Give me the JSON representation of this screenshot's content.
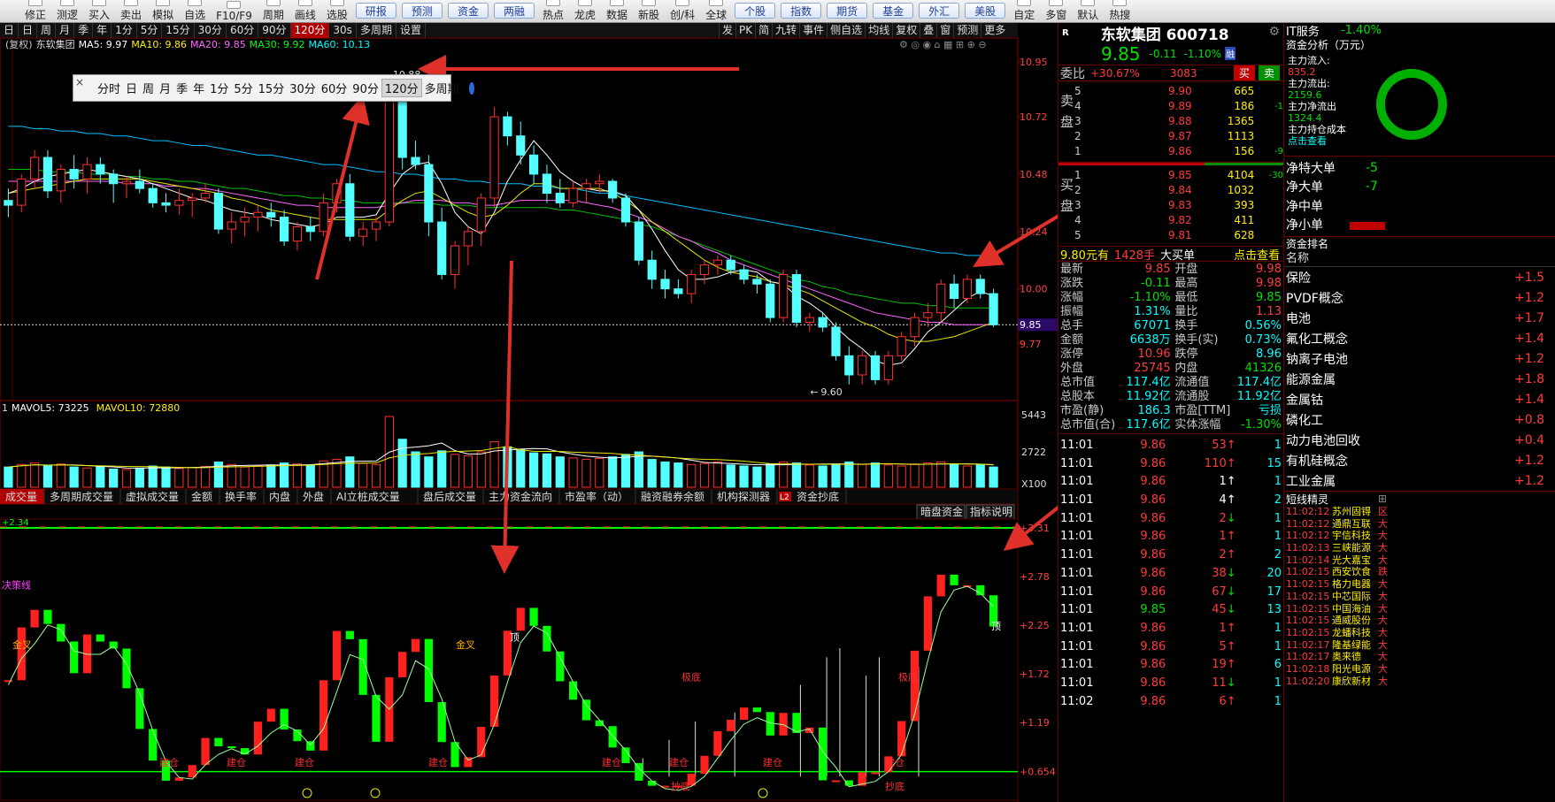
{
  "toolbar": {
    "items": [
      "修正",
      "测逻",
      "买入",
      "卖出",
      "模拟",
      "自选",
      "F10/F9",
      "周期",
      "画线",
      "选股"
    ],
    "buttons": [
      "研报",
      "预测",
      "资金",
      "两融"
    ],
    "items2": [
      "热点",
      "龙虎",
      "数据",
      "新股",
      "创/科"
    ],
    "item_global": "全球",
    "buttons2": [
      "个股",
      "指数",
      "期货",
      "基金",
      "外汇",
      "美股"
    ],
    "items3": [
      "自定",
      "多窗",
      "默认",
      "热搜"
    ]
  },
  "periodbar": {
    "items": [
      "日",
      "日",
      "周",
      "月",
      "季",
      "年",
      "1分",
      "5分",
      "15分",
      "30分",
      "60分",
      "90分",
      "120分",
      "30s",
      "多周期",
      "设置"
    ],
    "active_index": 12,
    "right_tools": [
      "发",
      "PK",
      "简",
      "九转",
      "事件",
      "侧自选",
      "均线",
      "复权",
      "叠",
      "窗",
      "预测",
      "更多"
    ]
  },
  "chart_header": {
    "fq": "(复权)",
    "name": "东软集团",
    "ma5": "MA5: 9.97",
    "ma10": "MA10: 9.86",
    "ma20": "MA20: 9.85",
    "ma30": "MA30: 9.92",
    "ma60": "MA60: 10.13"
  },
  "popup": {
    "items": [
      "分时",
      "日",
      "周",
      "月",
      "季",
      "年",
      "1分",
      "5分",
      "15分",
      "30分",
      "60分",
      "90分",
      "120分",
      "多周期"
    ],
    "selected": "120分",
    "close": "×"
  },
  "price_axis": [
    "10.95",
    "10.72",
    "10.48",
    "10.24",
    "10.00",
    "9.77"
  ],
  "last_price_tag": "9.85",
  "high_label": "10.88",
  "low_label": "9.60",
  "vol_header": {
    "prefix": "1",
    "mavol5": "MAVOL5: 73225",
    "mavol10": "MAVOL10: 72880"
  },
  "vol_axis": [
    "5443",
    "2722",
    "X100"
  ],
  "tabs": [
    "成交量",
    "多周期成交量",
    "虚拟成交量",
    "金额",
    "换手率",
    "内盘",
    "外盘",
    "AI立桩成交量",
    "盘后成交量",
    "主力资金流向",
    "市盈率（动）",
    "融资融券余额",
    "机构探测器",
    "资金抄底"
  ],
  "tab_l2_badge": "L2",
  "ind_buttons": [
    "暗盘资金",
    "指标说明"
  ],
  "ind_header_value": "+2.34",
  "ind_axis": [
    "+3.31",
    "+2.78",
    "+2.25",
    "+1.72",
    "+1.19",
    "+0.654"
  ],
  "ind_labels": {
    "jj": "决策线",
    "jincha1": "金叉",
    "jincha2": "金叉",
    "ding1": "顶",
    "ding2": "顶",
    "jidi1": "极底",
    "jidi2": "极底",
    "jiancang": "建仓",
    "chaodi": "抄底"
  },
  "chart_data": {
    "type": "candlestick",
    "candles": [
      [
        10.37,
        10.42,
        10.3,
        10.35
      ],
      [
        10.35,
        10.48,
        10.32,
        10.46
      ],
      [
        10.46,
        10.58,
        10.42,
        10.55
      ],
      [
        10.55,
        10.58,
        10.38,
        10.41
      ],
      [
        10.41,
        10.52,
        10.36,
        10.5
      ],
      [
        10.5,
        10.56,
        10.42,
        10.46
      ],
      [
        10.46,
        10.55,
        10.4,
        10.52
      ],
      [
        10.52,
        10.55,
        10.44,
        10.48
      ],
      [
        10.48,
        10.5,
        10.36,
        10.44
      ],
      [
        10.44,
        10.47,
        10.38,
        10.45
      ],
      [
        10.45,
        10.5,
        10.4,
        10.42
      ],
      [
        10.42,
        10.44,
        10.34,
        10.36
      ],
      [
        10.36,
        10.4,
        10.32,
        10.35
      ],
      [
        10.35,
        10.42,
        10.31,
        10.37
      ],
      [
        10.37,
        10.4,
        10.3,
        10.38
      ],
      [
        10.38,
        10.44,
        10.36,
        10.4
      ],
      [
        10.4,
        10.42,
        10.23,
        10.25
      ],
      [
        10.25,
        10.32,
        10.19,
        10.28
      ],
      [
        10.28,
        10.34,
        10.22,
        10.3
      ],
      [
        10.3,
        10.35,
        10.24,
        10.32
      ],
      [
        10.32,
        10.36,
        10.26,
        10.3
      ],
      [
        10.3,
        10.33,
        10.18,
        10.2
      ],
      [
        10.2,
        10.28,
        10.16,
        10.26
      ],
      [
        10.26,
        10.3,
        10.2,
        10.24
      ],
      [
        10.24,
        10.4,
        10.22,
        10.36
      ],
      [
        10.36,
        10.46,
        10.32,
        10.44
      ],
      [
        10.44,
        10.48,
        10.2,
        10.22
      ],
      [
        10.22,
        10.28,
        10.18,
        10.25
      ],
      [
        10.25,
        10.3,
        10.2,
        10.28
      ],
      [
        10.28,
        10.88,
        10.26,
        10.8
      ],
      [
        10.8,
        10.88,
        10.5,
        10.55
      ],
      [
        10.55,
        10.62,
        10.5,
        10.52
      ],
      [
        10.52,
        10.56,
        10.22,
        10.28
      ],
      [
        10.28,
        10.34,
        10.04,
        10.06
      ],
      [
        10.06,
        10.2,
        10.0,
        10.18
      ],
      [
        10.18,
        10.26,
        10.1,
        10.24
      ],
      [
        10.24,
        10.4,
        10.18,
        10.38
      ],
      [
        10.38,
        10.76,
        10.34,
        10.72
      ],
      [
        10.72,
        10.74,
        10.6,
        10.64
      ],
      [
        10.64,
        10.7,
        10.52,
        10.56
      ],
      [
        10.56,
        10.6,
        10.44,
        10.48
      ],
      [
        10.48,
        10.52,
        10.36,
        10.4
      ],
      [
        10.4,
        10.46,
        10.34,
        10.36
      ],
      [
        10.36,
        10.45,
        10.34,
        10.42
      ],
      [
        10.42,
        10.46,
        10.36,
        10.44
      ],
      [
        10.44,
        10.48,
        10.4,
        10.45
      ],
      [
        10.45,
        10.46,
        10.36,
        10.38
      ],
      [
        10.38,
        10.4,
        10.26,
        10.28
      ],
      [
        10.28,
        10.3,
        10.1,
        10.12
      ],
      [
        10.12,
        10.16,
        10.0,
        10.04
      ],
      [
        10.04,
        10.08,
        9.96,
        10.0
      ],
      [
        10.0,
        10.04,
        9.96,
        9.98
      ],
      [
        9.98,
        10.08,
        9.94,
        10.06
      ],
      [
        10.06,
        10.12,
        10.02,
        10.1
      ],
      [
        10.1,
        10.14,
        10.06,
        10.12
      ],
      [
        10.12,
        10.14,
        10.06,
        10.08
      ],
      [
        10.08,
        10.1,
        10.02,
        10.04
      ],
      [
        10.04,
        10.06,
        9.98,
        10.02
      ],
      [
        10.02,
        10.04,
        9.86,
        9.88
      ],
      [
        9.88,
        10.08,
        9.86,
        10.06
      ],
      [
        10.06,
        10.08,
        9.84,
        9.86
      ],
      [
        9.86,
        9.9,
        9.82,
        9.88
      ],
      [
        9.88,
        9.9,
        9.82,
        9.84
      ],
      [
        9.84,
        9.86,
        9.7,
        9.72
      ],
      [
        9.72,
        9.76,
        9.6,
        9.64
      ],
      [
        9.64,
        9.74,
        9.6,
        9.72
      ],
      [
        9.72,
        9.74,
        9.6,
        9.62
      ],
      [
        9.62,
        9.74,
        9.6,
        9.72
      ],
      [
        9.72,
        9.82,
        9.7,
        9.8
      ],
      [
        9.8,
        9.9,
        9.76,
        9.88
      ],
      [
        9.88,
        9.94,
        9.84,
        9.9
      ],
      [
        9.9,
        10.04,
        9.86,
        10.02
      ],
      [
        10.02,
        10.06,
        9.92,
        9.96
      ],
      [
        9.96,
        10.06,
        9.94,
        10.04
      ],
      [
        10.04,
        10.06,
        9.96,
        9.98
      ],
      [
        9.98,
        10.0,
        9.84,
        9.85
      ]
    ],
    "ma5": [
      10.4,
      10.42,
      10.45,
      10.47,
      10.48,
      10.49,
      10.5,
      10.49,
      10.48,
      10.47,
      10.46,
      10.44,
      10.42,
      10.4,
      10.38,
      10.37,
      10.35,
      10.33,
      10.32,
      10.31,
      10.29,
      10.28,
      10.27,
      10.26,
      10.27,
      10.3,
      10.3,
      10.3,
      10.31,
      10.4,
      10.48,
      10.52,
      10.53,
      10.44,
      10.32,
      10.26,
      10.23,
      10.32,
      10.45,
      10.54,
      10.62,
      10.56,
      10.49,
      10.45,
      10.42,
      10.41,
      10.41,
      10.39,
      10.33,
      10.25,
      10.16,
      10.08,
      10.04,
      10.04,
      10.05,
      10.07,
      10.08,
      10.07,
      10.03,
      10.02,
      9.97,
      9.94,
      9.9,
      9.84,
      9.79,
      9.75,
      9.7,
      9.68,
      9.69,
      9.75,
      9.82,
      9.86,
      9.91,
      9.96,
      9.99,
      9.97
    ],
    "ma10": [
      10.4,
      10.41,
      10.42,
      10.43,
      10.44,
      10.45,
      10.46,
      10.46,
      10.46,
      10.46,
      10.46,
      10.45,
      10.44,
      10.43,
      10.42,
      10.41,
      10.4,
      10.38,
      10.37,
      10.35,
      10.33,
      10.32,
      10.31,
      10.3,
      10.29,
      10.29,
      10.29,
      10.29,
      10.29,
      10.33,
      10.37,
      10.4,
      10.41,
      10.38,
      10.35,
      10.32,
      10.3,
      10.31,
      10.35,
      10.4,
      10.44,
      10.44,
      10.42,
      10.42,
      10.42,
      10.42,
      10.4,
      10.37,
      10.33,
      10.28,
      10.24,
      10.2,
      10.16,
      10.12,
      10.09,
      10.07,
      10.06,
      10.05,
      10.03,
      10.02,
      10.0,
      9.98,
      9.95,
      9.92,
      9.89,
      9.86,
      9.84,
      9.81,
      9.79,
      9.78,
      9.78,
      9.79,
      9.8,
      9.82,
      9.84,
      9.86
    ],
    "ma20": [
      10.45,
      10.45,
      10.45,
      10.45,
      10.45,
      10.45,
      10.45,
      10.45,
      10.45,
      10.44,
      10.44,
      10.44,
      10.43,
      10.43,
      10.42,
      10.42,
      10.41,
      10.4,
      10.39,
      10.38,
      10.37,
      10.36,
      10.35,
      10.35,
      10.34,
      10.34,
      10.34,
      10.34,
      10.34,
      10.35,
      10.36,
      10.37,
      10.37,
      10.37,
      10.36,
      10.36,
      10.35,
      10.35,
      10.36,
      10.37,
      10.37,
      10.37,
      10.37,
      10.37,
      10.36,
      10.35,
      10.34,
      10.32,
      10.3,
      10.28,
      10.25,
      10.22,
      10.2,
      10.17,
      10.15,
      10.12,
      10.1,
      10.08,
      10.06,
      10.04,
      10.02,
      10.0,
      9.98,
      9.96,
      9.94,
      9.92,
      9.9,
      9.89,
      9.88,
      9.87,
      9.86,
      9.86,
      9.85,
      9.85,
      9.85,
      9.85
    ],
    "ma30": [
      10.5,
      10.5,
      10.5,
      10.49,
      10.49,
      10.49,
      10.48,
      10.48,
      10.48,
      10.47,
      10.47,
      10.46,
      10.46,
      10.45,
      10.45,
      10.44,
      10.43,
      10.42,
      10.42,
      10.41,
      10.4,
      10.39,
      10.39,
      10.38,
      10.38,
      10.37,
      10.37,
      10.36,
      10.36,
      10.36,
      10.36,
      10.36,
      10.36,
      10.35,
      10.35,
      10.35,
      10.34,
      10.34,
      10.34,
      10.34,
      10.34,
      10.34,
      10.33,
      10.33,
      10.32,
      10.31,
      10.3,
      10.29,
      10.27,
      10.26,
      10.24,
      10.22,
      10.2,
      10.18,
      10.16,
      10.14,
      10.12,
      10.1,
      10.08,
      10.06,
      10.04,
      10.03,
      10.01,
      10.0,
      9.98,
      9.97,
      9.96,
      9.95,
      9.94,
      9.94,
      9.93,
      9.93,
      9.92,
      9.92,
      9.92,
      9.92
    ],
    "ma60": [
      10.68,
      10.68,
      10.67,
      10.67,
      10.66,
      10.66,
      10.65,
      10.65,
      10.64,
      10.64,
      10.63,
      10.62,
      10.62,
      10.61,
      10.6,
      10.6,
      10.59,
      10.58,
      10.57,
      10.56,
      10.56,
      10.55,
      10.54,
      10.53,
      10.52,
      10.52,
      10.51,
      10.5,
      10.49,
      10.49,
      10.48,
      10.48,
      10.47,
      10.46,
      10.46,
      10.45,
      10.45,
      10.44,
      10.44,
      10.44,
      10.43,
      10.43,
      10.42,
      10.42,
      10.41,
      10.4,
      10.4,
      10.39,
      10.38,
      10.37,
      10.36,
      10.35,
      10.34,
      10.33,
      10.32,
      10.31,
      10.3,
      10.29,
      10.28,
      10.27,
      10.26,
      10.25,
      10.24,
      10.23,
      10.22,
      10.21,
      10.2,
      10.19,
      10.18,
      10.17,
      10.16,
      10.15,
      10.15,
      10.14,
      10.14,
      10.13
    ],
    "volumes": [
      40,
      45,
      48,
      42,
      46,
      40,
      38,
      41,
      36,
      35,
      38,
      42,
      40,
      37,
      39,
      41,
      50,
      45,
      40,
      42,
      44,
      48,
      46,
      43,
      52,
      55,
      60,
      47,
      45,
      140,
      95,
      70,
      60,
      72,
      65,
      62,
      70,
      90,
      80,
      75,
      68,
      66,
      60,
      58,
      55,
      57,
      60,
      65,
      70,
      55,
      50,
      48,
      45,
      47,
      50,
      44,
      42,
      40,
      46,
      50,
      48,
      44,
      42,
      46,
      50,
      45,
      48,
      44,
      42,
      46,
      48,
      50,
      45,
      42,
      44,
      40
    ],
    "ylim": [
      9.54,
      11.02
    ]
  },
  "right": {
    "watch_prefix": "R",
    "title": "东软集团 600718",
    "price": "9.85",
    "change": "-0.11",
    "pct": "-1.10%",
    "tag": "融",
    "weibi_label": "委比",
    "weibi": "+30.67%",
    "weibi_diff": "3083",
    "buy_btn": "买",
    "sell_btn": "卖",
    "sell_side": "卖盘",
    "buy_side": "买盘",
    "asks": [
      {
        "lvl": "5",
        "p": "9.90",
        "v": "665",
        "d": ""
      },
      {
        "lvl": "4",
        "p": "9.89",
        "v": "186",
        "d": "-1"
      },
      {
        "lvl": "3",
        "p": "9.88",
        "v": "1365",
        "d": ""
      },
      {
        "lvl": "2",
        "p": "9.87",
        "v": "1113",
        "d": ""
      },
      {
        "lvl": "1",
        "p": "9.86",
        "v": "156",
        "d": "-9"
      }
    ],
    "bids": [
      {
        "lvl": "1",
        "p": "9.85",
        "v": "4104",
        "d": "-30"
      },
      {
        "lvl": "2",
        "p": "9.84",
        "v": "1032",
        "d": ""
      },
      {
        "lvl": "3",
        "p": "9.83",
        "v": "393",
        "d": ""
      },
      {
        "lvl": "4",
        "p": "9.82",
        "v": "411",
        "d": ""
      },
      {
        "lvl": "5",
        "p": "9.81",
        "v": "628",
        "d": ""
      }
    ],
    "bigorder": {
      "price": "9.80元有",
      "hands": "1428手",
      "label": "大买单",
      "link": "点击查看"
    },
    "stats": [
      [
        "最新",
        "9.85",
        "开盘",
        "9.98"
      ],
      [
        "涨跌",
        "-0.11",
        "最高",
        "9.98"
      ],
      [
        "涨幅",
        "-1.10%",
        "最低",
        "9.85"
      ],
      [
        "振幅",
        "1.31%",
        "量比",
        "1.13"
      ],
      [
        "总手",
        "67071",
        "换手",
        "0.56%"
      ],
      [
        "金额",
        "6638万",
        "换手(实)",
        "0.73%"
      ],
      [
        "涨停",
        "10.96",
        "跌停",
        "8.96"
      ],
      [
        "外盘",
        "25745",
        "内盘",
        "41326"
      ],
      [
        "总市值",
        "117.4亿",
        "流通值",
        "117.4亿"
      ],
      [
        "总股本",
        "11.92亿",
        "流通股",
        "11.92亿"
      ],
      [
        "市盈(静)",
        "186.3",
        "市盈[TTM]",
        "亏损"
      ],
      [
        "总市值(合)",
        "117.6亿",
        "实体涨幅",
        "-1.30%"
      ]
    ],
    "ticks": [
      [
        "11:01",
        "9.86",
        "53",
        "up",
        "1"
      ],
      [
        "11:01",
        "9.86",
        "110",
        "up",
        "15"
      ],
      [
        "11:01",
        "9.86",
        "1",
        "upw",
        "1"
      ],
      [
        "11:01",
        "9.86",
        "4",
        "upw",
        "2"
      ],
      [
        "11:01",
        "9.86",
        "2",
        "down",
        "1"
      ],
      [
        "11:01",
        "9.86",
        "1",
        "up",
        "1"
      ],
      [
        "11:01",
        "9.86",
        "2",
        "up",
        "2"
      ],
      [
        "11:01",
        "9.86",
        "38",
        "down",
        "20"
      ],
      [
        "11:01",
        "9.86",
        "67",
        "down",
        "17"
      ],
      [
        "11:01",
        "9.85",
        "45",
        "down",
        "13"
      ],
      [
        "11:01",
        "9.86",
        "1",
        "up",
        "1"
      ],
      [
        "11:01",
        "9.86",
        "5",
        "up",
        "1"
      ],
      [
        "11:01",
        "9.86",
        "19",
        "up",
        "6"
      ],
      [
        "11:01",
        "9.86",
        "11",
        "down",
        "1"
      ],
      [
        "11:02",
        "9.86",
        "6",
        "up",
        "1"
      ]
    ]
  },
  "far": {
    "sector": "IT服务",
    "sector_pct": "-1.40%",
    "fund_title": "资金分析（万元）",
    "fund_lines": [
      {
        "t": "主力流入:",
        "c": "white"
      },
      {
        "t": "835.2",
        "c": "red"
      },
      {
        "t": "主力流出:",
        "c": "white"
      },
      {
        "t": "2159.6",
        "c": "green"
      },
      {
        "t": "主力净流出",
        "c": "white"
      },
      {
        "t": "1324.4",
        "c": "green"
      },
      {
        "t": "主力持仓成本",
        "c": "white"
      },
      {
        "t": "点击查看",
        "c": "cyan"
      }
    ],
    "net": [
      [
        "净特大单",
        "-5"
      ],
      [
        "净大单",
        "-7"
      ],
      [
        "净中单",
        ""
      ],
      [
        "净小单",
        ""
      ]
    ],
    "rank_title": "资金排名",
    "rank_header": "名称",
    "ranks": [
      [
        "保险",
        "+1.5"
      ],
      [
        "PVDF概念",
        "+1.2"
      ],
      [
        "电池",
        "+1.7"
      ],
      [
        "氟化工概念",
        "+1.4"
      ],
      [
        "钠离子电池",
        "+1.2"
      ],
      [
        "能源金属",
        "+1.8"
      ],
      [
        "金属钴",
        "+1.4"
      ],
      [
        "磷化工",
        "+0.8"
      ],
      [
        "动力电池回收",
        "+0.4"
      ],
      [
        "有机硅概念",
        "+1.2"
      ],
      [
        "工业金属",
        "+1.2"
      ]
    ],
    "sprite_title": "短线精灵",
    "sprites": [
      [
        "11:02:12",
        "苏州固锝",
        "区"
      ],
      [
        "11:02:12",
        "通鼎互联",
        "大"
      ],
      [
        "11:02:12",
        "宇信科技",
        "大"
      ],
      [
        "11:02:13",
        "三峡能源",
        "大"
      ],
      [
        "11:02:14",
        "光大嘉宝",
        "大"
      ],
      [
        "11:02:15",
        "西安饮食",
        "跌"
      ],
      [
        "11:02:15",
        "格力电器",
        "大"
      ],
      [
        "11:02:15",
        "中芯国际",
        "大"
      ],
      [
        "11:02:15",
        "中国海油",
        "大"
      ],
      [
        "11:02:15",
        "通威股份",
        "大"
      ],
      [
        "11:02:15",
        "龙蟠科技",
        "大"
      ],
      [
        "11:02:17",
        "隆基绿能",
        "大"
      ],
      [
        "11:02:17",
        "奥来德",
        "大"
      ],
      [
        "11:02:18",
        "阳光电源",
        "大"
      ],
      [
        "11:02:20",
        "康欣新材",
        "大"
      ]
    ]
  }
}
